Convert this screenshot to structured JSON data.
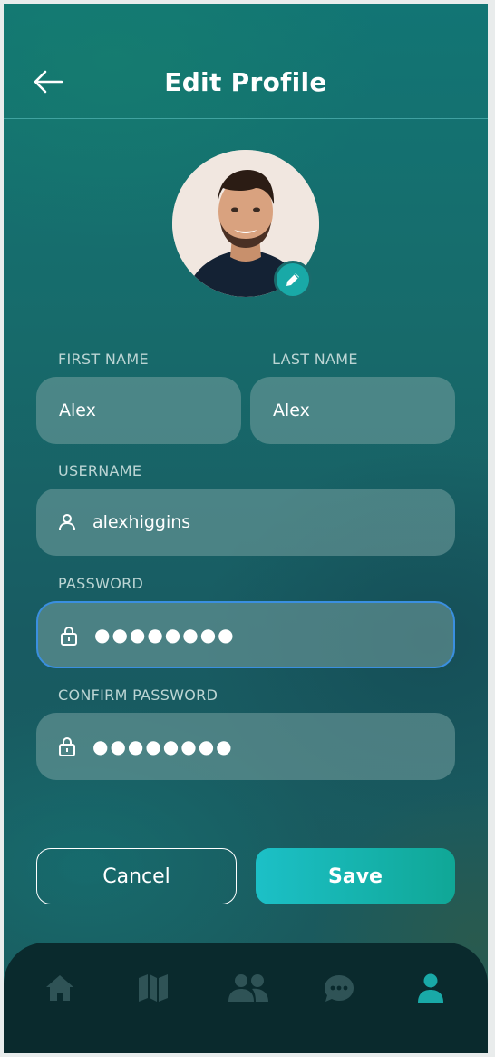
{
  "header": {
    "title": "Edit Profile",
    "back_icon": "arrow-left-icon"
  },
  "profile": {
    "avatar_alt": "profile photo",
    "edit_icon": "pencil-icon"
  },
  "form": {
    "first_name": {
      "label": "FIRST NAME",
      "value": "Alex"
    },
    "last_name": {
      "label": "LAST NAME",
      "value": "Alex"
    },
    "username": {
      "label": "USERNAME",
      "value": "alexhiggins",
      "icon": "user-icon"
    },
    "password": {
      "label": "PASSWORD",
      "masked": "●●●●●●●●",
      "icon": "lock-icon",
      "focused": true
    },
    "confirm_password": {
      "label": "CONFIRM PASSWORD",
      "masked": "●●●●●●●●",
      "icon": "lock-icon"
    }
  },
  "actions": {
    "cancel_label": "Cancel",
    "save_label": "Save"
  },
  "bottom_nav": {
    "items": [
      {
        "icon": "home-icon",
        "active": false
      },
      {
        "icon": "map-icon",
        "active": false
      },
      {
        "icon": "users-icon",
        "active": false
      },
      {
        "icon": "chat-icon",
        "active": false
      },
      {
        "icon": "profile-icon",
        "active": true
      }
    ]
  },
  "colors": {
    "accent": "#19a9a7",
    "focus_border": "#3a8fe0",
    "nav_bg": "#0a2a2d",
    "nav_inactive": "#2f5356"
  }
}
